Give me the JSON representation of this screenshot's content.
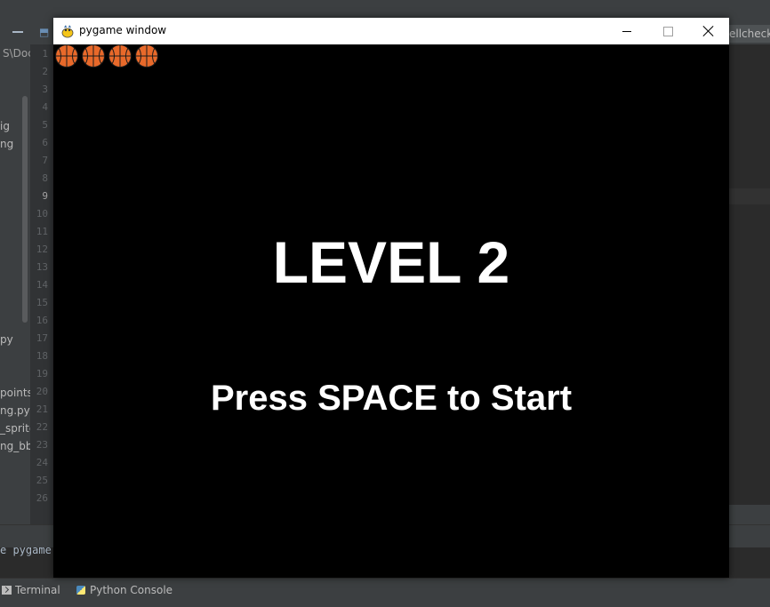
{
  "ide": {
    "tab_right_label": "ellcheck.",
    "project_path": "S\\Doc",
    "project_items": [
      "ig",
      "ng",
      "py",
      "points_",
      "ng.py",
      "_sprites",
      "ng_bba"
    ],
    "line_numbers": [
      "1",
      "2",
      "3",
      "4",
      "5",
      "6",
      "7",
      "8",
      "9",
      "10",
      "11",
      "12",
      "13",
      "14",
      "15",
      "16",
      "17",
      "18",
      "19",
      "20",
      "21",
      "22",
      "23",
      "24",
      "25",
      "26"
    ],
    "run_output": "e pygame",
    "bottom_tabs": {
      "terminal": "Terminal",
      "python_console": "Python Console"
    }
  },
  "pygame_window": {
    "title": "pygame window",
    "controls": [
      "minimize",
      "maximize",
      "close"
    ],
    "lives_count": 4,
    "level_text": "LEVEL 2",
    "prompt_text": "Press SPACE to Start",
    "colors": {
      "background": "#000000",
      "text": "#ffffff",
      "ball": "#e8692a",
      "titlebar": "#ffffff"
    }
  }
}
